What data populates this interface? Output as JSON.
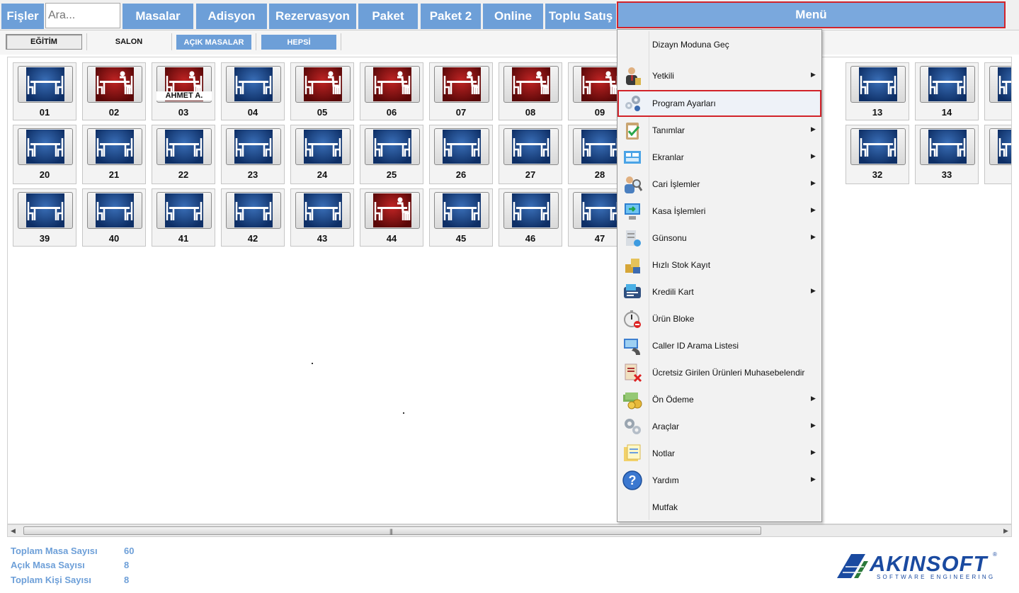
{
  "topbar": {
    "fisler_label": "Fişler",
    "search_placeholder": "Ara...",
    "masalar_label": "Masalar",
    "adisyon_label": "Adisyon",
    "rezervasyon_label": "Rezervasyon",
    "paket_label": "Paket",
    "paket2_label": "Paket 2",
    "online_label": "Online",
    "toplu_satis_label": "Toplu Satış",
    "menu_label": "Menü"
  },
  "filters": {
    "egitim": "EĞİTİM",
    "salon": "SALON",
    "acik_masalar": "AÇIK MASALAR",
    "hepsi": "HEPSİ"
  },
  "tables": [
    {
      "num": "01",
      "status": "empty",
      "name": ""
    },
    {
      "num": "02",
      "status": "occupied",
      "name": ""
    },
    {
      "num": "03",
      "status": "occupied",
      "name": "AHMET A."
    },
    {
      "num": "04",
      "status": "empty",
      "name": ""
    },
    {
      "num": "05",
      "status": "occupied",
      "name": ""
    },
    {
      "num": "06",
      "status": "occupied",
      "name": ""
    },
    {
      "num": "07",
      "status": "occupied",
      "name": ""
    },
    {
      "num": "08",
      "status": "occupied",
      "name": ""
    },
    {
      "num": "09",
      "status": "occupied",
      "name": ""
    },
    {
      "num": "13",
      "status": "empty",
      "name": ""
    },
    {
      "num": "14",
      "status": "empty",
      "name": ""
    },
    {
      "num": "",
      "status": "empty",
      "name": ""
    },
    {
      "num": "20",
      "status": "empty",
      "name": ""
    },
    {
      "num": "21",
      "status": "empty",
      "name": ""
    },
    {
      "num": "22",
      "status": "empty",
      "name": ""
    },
    {
      "num": "23",
      "status": "empty",
      "name": ""
    },
    {
      "num": "24",
      "status": "empty",
      "name": ""
    },
    {
      "num": "25",
      "status": "empty",
      "name": ""
    },
    {
      "num": "26",
      "status": "empty",
      "name": ""
    },
    {
      "num": "27",
      "status": "empty",
      "name": ""
    },
    {
      "num": "28",
      "status": "empty",
      "name": ""
    },
    {
      "num": "32",
      "status": "empty",
      "name": ""
    },
    {
      "num": "33",
      "status": "empty",
      "name": ""
    },
    {
      "num": "",
      "status": "empty",
      "name": ""
    },
    {
      "num": "39",
      "status": "empty",
      "name": ""
    },
    {
      "num": "40",
      "status": "empty",
      "name": ""
    },
    {
      "num": "41",
      "status": "empty",
      "name": ""
    },
    {
      "num": "42",
      "status": "empty",
      "name": ""
    },
    {
      "num": "43",
      "status": "empty",
      "name": ""
    },
    {
      "num": "44",
      "status": "occupied",
      "name": ""
    },
    {
      "num": "45",
      "status": "empty",
      "name": ""
    },
    {
      "num": "46",
      "status": "empty",
      "name": ""
    },
    {
      "num": "47",
      "status": "empty",
      "name": ""
    }
  ],
  "footer": {
    "toplam_masa_label": "Toplam Masa Sayısı",
    "toplam_masa_value": "60",
    "acik_masa_label": "Açık Masa Sayısı",
    "acik_masa_value": "8",
    "toplam_kisi_label": "Toplam Kişi Sayısı",
    "toplam_kisi_value": "8"
  },
  "logo": {
    "name": "AKINSOFT",
    "tagline": "SOFTWARE ENGINEERING",
    "registered": "®"
  },
  "menu": {
    "items": [
      {
        "label": "Dizayn Moduna Geç",
        "submenu": false,
        "icon": "design-icon"
      },
      {
        "label": "Yetkili",
        "submenu": true,
        "icon": "user-key-icon"
      },
      {
        "label": "Program Ayarları",
        "submenu": false,
        "icon": "gears-user-icon"
      },
      {
        "label": "Tanımlar",
        "submenu": true,
        "icon": "clipboard-check-icon"
      },
      {
        "label": "Ekranlar",
        "submenu": true,
        "icon": "screens-icon"
      },
      {
        "label": "Cari İşlemler",
        "submenu": true,
        "icon": "customer-search-icon"
      },
      {
        "label": "Kasa İşlemleri",
        "submenu": true,
        "icon": "cash-monitor-icon"
      },
      {
        "label": "Günsonu",
        "submenu": true,
        "icon": "day-end-icon"
      },
      {
        "label": "Hızlı Stok Kayıt",
        "submenu": false,
        "icon": "stock-boxes-icon"
      },
      {
        "label": "Kredili Kart",
        "submenu": true,
        "icon": "card-reader-icon"
      },
      {
        "label": "Ürün Bloke",
        "submenu": false,
        "icon": "stopwatch-block-icon"
      },
      {
        "label": "Caller ID Arama Listesi",
        "submenu": false,
        "icon": "caller-id-icon"
      },
      {
        "label": "Ücretsiz Girilen Ürünleri Muhasebelendir",
        "submenu": false,
        "icon": "invoice-delete-icon"
      },
      {
        "label": "Ön Ödeme",
        "submenu": true,
        "icon": "money-coins-icon"
      },
      {
        "label": "Araçlar",
        "submenu": true,
        "icon": "tools-gears-icon"
      },
      {
        "label": "Notlar",
        "submenu": true,
        "icon": "notes-folder-icon"
      },
      {
        "label": "Yardım",
        "submenu": true,
        "icon": "help-icon"
      },
      {
        "label": "Mutfak",
        "submenu": false,
        "icon": ""
      }
    ]
  },
  "colors": {
    "tab_blue": "#6d9fd8",
    "menu_blue": "#7aa8dd",
    "highlight_red": "#d2232a",
    "table_blue": "#1a4a8f",
    "table_red": "#9b1111"
  }
}
